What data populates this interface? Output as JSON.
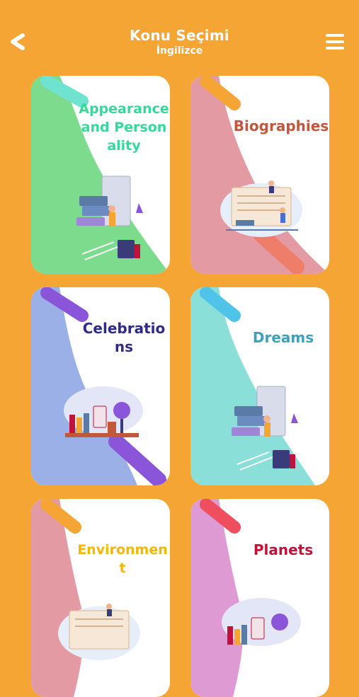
{
  "header": {
    "title": "Konu Seçimi",
    "subtitle": "İngilizce"
  },
  "topics": [
    {
      "label": "Appearance and Personality",
      "text_color": "#36D99A",
      "bg_color": "#7DDB8D",
      "stripe_color": "#6FE3D0",
      "illustration": "books-reading-icon"
    },
    {
      "label": "Biographies",
      "text_color": "#C2573A",
      "bg_color": "#E39AA3",
      "stripe_color": "#F4A533",
      "illustration": "study-board-icon"
    },
    {
      "label": "Celebrations",
      "text_color": "#2E2A8F",
      "bg_color": "#9AB0E6",
      "stripe_color": "#8A55D8",
      "illustration": "bookshelf-globe-icon"
    },
    {
      "label": "Dreams",
      "text_color": "#3F9FBF",
      "bg_color": "#8ADFD9",
      "stripe_color": "#4FC3E8",
      "illustration": "books-reading-icon"
    },
    {
      "label": "Environment",
      "text_color": "#F5B800",
      "bg_color": "#E39AA3",
      "stripe_color": "#F4A533",
      "illustration": "study-board-icon"
    },
    {
      "label": "Planets",
      "text_color": "#C0123A",
      "bg_color": "#DE9AD3",
      "stripe_color": "#EE4E5E",
      "illustration": "bookshelf-globe-icon"
    }
  ]
}
